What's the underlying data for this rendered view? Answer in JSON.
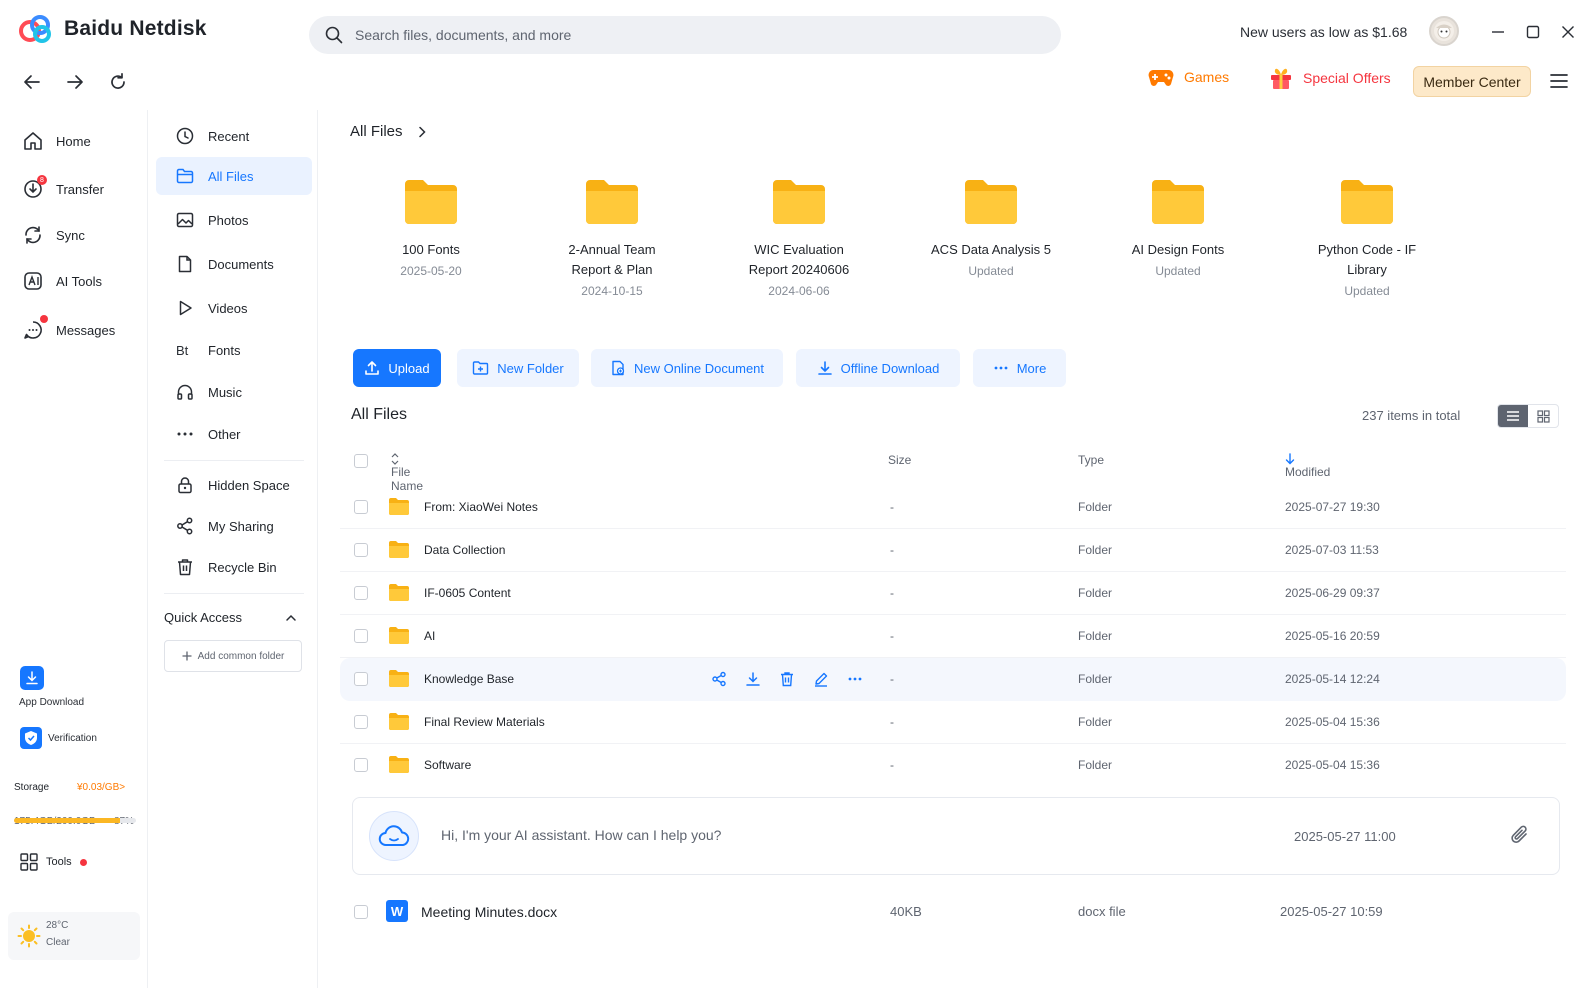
{
  "app": {
    "title": "Baidu Netdisk"
  },
  "search": {
    "placeholder": "Search files, documents, and more"
  },
  "header": {
    "promo": "New users as low as $1.68",
    "games": "Games",
    "offers": "Special Offers",
    "member": "Member Center"
  },
  "rail": {
    "home": "Home",
    "transfer": "Transfer",
    "transfer_badge": "8",
    "sync": "Sync",
    "ai_tools": "AI Tools",
    "messages": "Messages",
    "app_download": "App Download",
    "verification": "Verification",
    "storage_label": "Storage",
    "storage_price": "¥0.03/GB>",
    "storage_used": "175.4GB/200.0GB",
    "storage_percent": "87%",
    "storage_fraction": 0.87,
    "tools": "Tools",
    "weather_temp": "28°C",
    "weather_desc": "Clear"
  },
  "nav": {
    "recent": "Recent",
    "all_files": "All Files",
    "photos": "Photos",
    "documents": "Documents",
    "videos": "Videos",
    "fonts": "Fonts",
    "music": "Music",
    "other": "Other",
    "hidden": "Hidden Space",
    "sharing": "My Sharing",
    "recycle": "Recycle Bin",
    "quick_access": "Quick Access",
    "add_folder": "Add common folder"
  },
  "main": {
    "breadcrumb": "All Files",
    "quick": [
      {
        "name1": "100 Fonts",
        "name2": "",
        "sub": "2025-05-20"
      },
      {
        "name1": "2-Annual Team",
        "name2": "Report & Plan",
        "sub": "2024-10-15"
      },
      {
        "name1": "WIC Evaluation",
        "name2": "Report 20240606",
        "sub": "2024-06-06"
      },
      {
        "name1": "ACS Data Analysis 5",
        "name2": "",
        "sub": "Updated"
      },
      {
        "name1": "AI Design Fonts",
        "name2": "",
        "sub": "Updated"
      },
      {
        "name1": "Python Code - IF",
        "name2": "Library",
        "sub": "Updated"
      }
    ],
    "actions": {
      "upload": "Upload",
      "new_folder": "New Folder",
      "new_doc": "New Online Document",
      "offline": "Offline Download",
      "more": "More"
    },
    "section_title": "All Files",
    "count": "237 items in total",
    "columns": {
      "name": "File Name",
      "size": "Size",
      "type": "Type",
      "modified": "Modified"
    },
    "rows": [
      {
        "name": "From: XiaoWei Notes",
        "size": "-",
        "type": "Folder",
        "modified": "2025-07-27 19:30"
      },
      {
        "name": "Data Collection",
        "size": "-",
        "type": "Folder",
        "modified": "2025-07-03 11:53"
      },
      {
        "name": "IF-0605 Content",
        "size": "-",
        "type": "Folder",
        "modified": "2025-06-29 09:37"
      },
      {
        "name": "AI",
        "size": "-",
        "type": "Folder",
        "modified": "2025-05-16 20:59"
      },
      {
        "name": "Knowledge Base",
        "size": "-",
        "type": "Folder",
        "modified": "2025-05-14 12:24"
      },
      {
        "name": "Final Review Materials",
        "size": "-",
        "type": "Folder",
        "modified": "2025-05-04 15:36"
      },
      {
        "name": "Software",
        "size": "-",
        "type": "Folder",
        "modified": "2025-05-04 15:36"
      }
    ],
    "ai": {
      "text": "Hi, I'm your AI assistant. How can I help you?",
      "time": "2025-05-27 11:00"
    },
    "doc_row": {
      "icon_letter": "W",
      "name": "Meeting Minutes.docx",
      "size": "40KB",
      "type": "docx file",
      "modified": "2025-05-27 10:59"
    }
  },
  "colors": {
    "accent": "#1677ff",
    "folder": "#fbbf24",
    "games": "#ff7a00",
    "offers": "#f5353f",
    "member_bg": "#fde9c9"
  },
  "icons": [
    "search-icon",
    "back-icon",
    "forward-icon",
    "refresh-icon",
    "minimize-icon",
    "maximize-icon",
    "close-icon",
    "games-icon",
    "gift-icon",
    "menu-icon",
    "home-icon",
    "transfer-icon",
    "sync-icon",
    "ai-tools-icon",
    "messages-icon",
    "clock-icon",
    "folder-icon",
    "image-icon",
    "document-icon",
    "play-icon",
    "fonts-icon",
    "headphones-icon",
    "more-icon",
    "lock-icon",
    "share-icon",
    "trash-icon",
    "chevron-up-icon",
    "plus-icon",
    "upload-icon",
    "new-folder-icon",
    "new-doc-icon",
    "download-icon",
    "list-view-icon",
    "grid-view-icon",
    "sort-icon",
    "arrow-down-icon",
    "edit-icon",
    "cloud-icon",
    "paperclip-icon",
    "sun-icon",
    "shield-icon",
    "tools-icon"
  ]
}
